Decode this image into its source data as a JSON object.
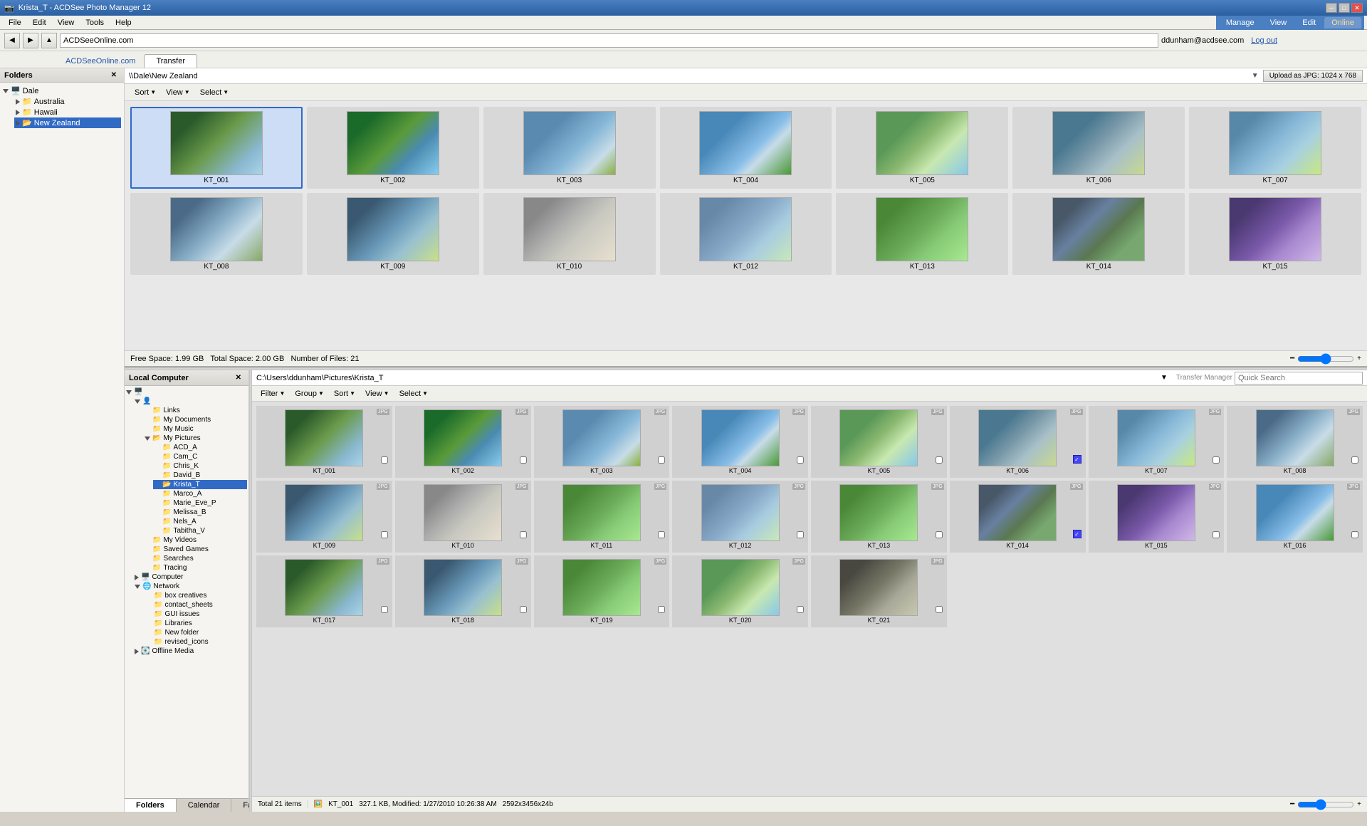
{
  "app": {
    "title": "Krista_T - ACDSee Photo Manager 12",
    "icon": "📷"
  },
  "title_bar": {
    "minimize_label": "─",
    "maximize_label": "□",
    "close_label": "✕"
  },
  "menu": {
    "items": [
      "File",
      "Edit",
      "View",
      "Tools",
      "Help"
    ]
  },
  "nav": {
    "back_label": "◀",
    "forward_label": "▶",
    "up_label": "▲",
    "address": "ACDSeeOnline.com"
  },
  "mode_tabs": {
    "items": [
      "Manage",
      "View",
      "Edit",
      "Online"
    ],
    "active": "Online"
  },
  "user_bar": {
    "email": "ddunham@acdsee.com",
    "logout_label": "Log out"
  },
  "tab_bar": {
    "online_label": "ACDSeeOnline.com",
    "transfer_label": "Transfer",
    "active": "Transfer"
  },
  "remote": {
    "path": "\\\\Dale\\New Zealand",
    "toolbar": {
      "sort_label": "Sort",
      "view_label": "View",
      "select_label": "Select"
    },
    "upload_btn": "Upload as JPG: 1024 x 768",
    "status": {
      "free_space": "Free Space: 1.99 GB",
      "total_space": "Total Space: 2.00 GB",
      "num_files": "Number of Files: 21"
    },
    "photos": [
      {
        "id": "KT_001",
        "cls": "photo-nz1",
        "selected": true
      },
      {
        "id": "KT_002",
        "cls": "photo-nz2",
        "selected": false
      },
      {
        "id": "KT_003",
        "cls": "photo-nz3",
        "selected": false
      },
      {
        "id": "KT_004",
        "cls": "photo-nz4",
        "selected": false
      },
      {
        "id": "KT_005",
        "cls": "photo-nz5",
        "selected": false
      },
      {
        "id": "KT_006",
        "cls": "photo-nz6",
        "selected": false
      },
      {
        "id": "KT_007",
        "cls": "photo-nz7",
        "selected": false
      },
      {
        "id": "KT_008",
        "cls": "photo-nz8",
        "selected": false
      },
      {
        "id": "KT_009",
        "cls": "photo-nz9",
        "selected": false
      },
      {
        "id": "KT_010",
        "cls": "photo-nz10",
        "selected": false
      },
      {
        "id": "KT_012",
        "cls": "photo-nz12",
        "selected": false
      },
      {
        "id": "KT_013",
        "cls": "photo-nz11",
        "selected": false
      },
      {
        "id": "KT_014",
        "cls": "photo-nz13",
        "selected": false
      },
      {
        "id": "KT_015",
        "cls": "photo-nz14",
        "selected": false
      }
    ]
  },
  "folders_panel": {
    "title": "Folders",
    "close_label": "✕",
    "items": [
      {
        "label": "Dale",
        "level": 0,
        "expanded": true,
        "type": "root"
      },
      {
        "label": "Australia",
        "level": 1,
        "expanded": false,
        "type": "folder"
      },
      {
        "label": "Hawaii",
        "level": 1,
        "expanded": false,
        "type": "folder"
      },
      {
        "label": "New Zealand",
        "level": 1,
        "expanded": false,
        "type": "folder",
        "selected": true
      }
    ]
  },
  "local_panel": {
    "title": "Local Computer",
    "close_label": "✕",
    "path": "C:\\Users\\ddunham\\Pictures\\Krista_T",
    "quick_search_placeholder": "Quick Search",
    "toolbar": {
      "filter_label": "Filter",
      "group_label": "Group",
      "sort_label": "Sort",
      "view_label": "View",
      "select_label": "Select"
    },
    "transfer_manager_label": "Transfer Manager",
    "photos": [
      {
        "id": "KT_001",
        "cls": "photo-nz1",
        "badge": "JPG",
        "checked": false
      },
      {
        "id": "KT_002",
        "cls": "photo-nz2",
        "badge": "JPG",
        "checked": false
      },
      {
        "id": "KT_003",
        "cls": "photo-nz3",
        "badge": "JPG",
        "checked": false
      },
      {
        "id": "KT_004",
        "cls": "photo-nz4",
        "badge": "JPG",
        "checked": false
      },
      {
        "id": "KT_005",
        "cls": "photo-nz5",
        "badge": "JPG",
        "checked": false
      },
      {
        "id": "KT_006",
        "cls": "photo-nz6",
        "badge": "JPG",
        "checked": true
      },
      {
        "id": "KT_007",
        "cls": "photo-nz7",
        "badge": "JPG",
        "checked": false
      },
      {
        "id": "KT_008",
        "cls": "photo-nz8",
        "badge": "JPG",
        "checked": false
      },
      {
        "id": "KT_009",
        "cls": "photo-nz9",
        "badge": "JPG",
        "checked": false
      },
      {
        "id": "KT_010",
        "cls": "photo-nz10",
        "badge": "JPG",
        "checked": false
      },
      {
        "id": "KT_011",
        "cls": "photo-nz11",
        "badge": "JPG",
        "checked": false
      },
      {
        "id": "KT_012",
        "cls": "photo-nz12",
        "badge": "JPG",
        "checked": false
      },
      {
        "id": "KT_013",
        "cls": "photo-nz11",
        "badge": "JPG",
        "checked": false
      },
      {
        "id": "KT_014",
        "cls": "photo-nz13",
        "badge": "JPG",
        "checked": true
      },
      {
        "id": "KT_015",
        "cls": "photo-nz14",
        "badge": "JPG",
        "checked": false
      },
      {
        "id": "KT_016",
        "cls": "photo-nz4",
        "badge": "JPG",
        "checked": false
      },
      {
        "id": "KT_017",
        "cls": "photo-nz1",
        "badge": "JPG",
        "checked": false
      },
      {
        "id": "KT_018",
        "cls": "photo-nz9",
        "badge": "JPG",
        "checked": false
      },
      {
        "id": "KT_019",
        "cls": "photo-nz11",
        "badge": "JPG",
        "checked": false
      },
      {
        "id": "KT_020",
        "cls": "photo-nz5",
        "badge": "JPG",
        "checked": false
      },
      {
        "id": "KT_021",
        "cls": "photo-nz15",
        "badge": "JPG",
        "checked": false
      }
    ]
  },
  "local_folder_tree": {
    "items": [
      {
        "label": "Links",
        "level": 2
      },
      {
        "label": "My Documents",
        "level": 2
      },
      {
        "label": "My Music",
        "level": 2
      },
      {
        "label": "My Pictures",
        "level": 2,
        "expanded": true
      },
      {
        "label": "ACD_A",
        "level": 3
      },
      {
        "label": "Cam_C",
        "level": 3
      },
      {
        "label": "Chris_K",
        "level": 3
      },
      {
        "label": "David_B",
        "level": 3
      },
      {
        "label": "Krista_T",
        "level": 3,
        "selected": true
      },
      {
        "label": "Marco_A",
        "level": 3
      },
      {
        "label": "Marie_Eve_P",
        "level": 3
      },
      {
        "label": "Melissa_B",
        "level": 3
      },
      {
        "label": "Nels_A",
        "level": 3
      },
      {
        "label": "Tabitha_V",
        "level": 3
      },
      {
        "label": "My Videos",
        "level": 2
      },
      {
        "label": "Saved Games",
        "level": 2
      },
      {
        "label": "Searches",
        "level": 2
      },
      {
        "label": "Tracing",
        "level": 2
      },
      {
        "label": "Network",
        "level": 1,
        "expanded": true
      },
      {
        "label": "box creatives",
        "level": 2
      },
      {
        "label": "contact_sheets",
        "level": 2
      },
      {
        "label": "GUI issues",
        "level": 2
      },
      {
        "label": "Libraries",
        "level": 2
      },
      {
        "label": "New folder",
        "level": 2
      },
      {
        "label": "revised_icons",
        "level": 2
      },
      {
        "label": "Offline Media",
        "level": 1
      }
    ]
  },
  "status_bar": {
    "total_items": "Total 21 items",
    "selected_file": "KT_001",
    "file_size": "327.1 KB, Modified: 1/27/2010 10:26:38 AM",
    "dimensions": "2592x3456x24b"
  },
  "bottom_tabs": {
    "folders_label": "Folders",
    "calendar_label": "Calendar",
    "favorites_label": "Favorites",
    "active": "Folders"
  },
  "zoom_bar": {
    "zoom_out": "─",
    "zoom_in": "+"
  }
}
